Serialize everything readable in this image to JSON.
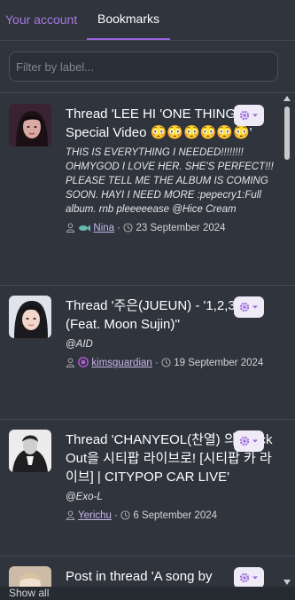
{
  "tabs": [
    {
      "label": "Your account"
    },
    {
      "label": "Bookmarks"
    }
  ],
  "filter": {
    "placeholder": "Filter by label..."
  },
  "items": [
    {
      "title": "Thread 'LEE HI 'ONE THING' Special Video 😳😳😳😳😳😳'",
      "description": "THIS IS EVERYTHING I NEEDED!!!!!!!! OHMYGOD I LOVE HER. SHE'S PERFECT!!! PLEASE TELL ME THE ALBUM IS COMING SOON. HAYI I NEED MORE :pepecry1:Full album. rnb pleeeeease @Hice Cream",
      "user": "Nina",
      "date": "23 September 2024"
    },
    {
      "title": "Thread '주은(JUEUN) - '1,2,3,4 (Feat. Moon Sujin)''",
      "description": "@AID",
      "user": "kimsguardian",
      "date": "19 September 2024"
    },
    {
      "title": "Thread 'CHANYEOL(찬열) 의 Black Out을 시티팝 라이브로! [시티팝 카 라이브] | CITYPOP CAR LIVE'",
      "description": "@Exo-L",
      "user": "Yerichu",
      "date": "6 September 2024"
    },
    {
      "title": "Post in thread 'A song by"
    }
  ],
  "footer": {
    "label": "Show all"
  },
  "colors": {
    "accent": "#9a63dd",
    "background": "#2f343d"
  }
}
